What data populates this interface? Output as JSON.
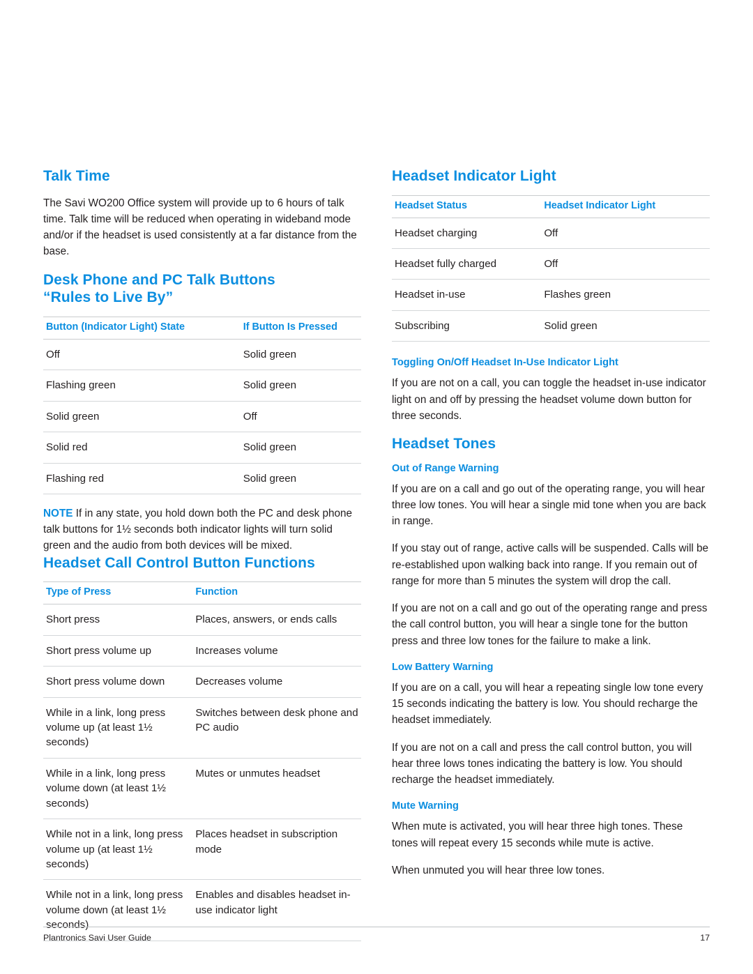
{
  "left": {
    "talk_time": {
      "heading": "Talk Time",
      "paragraph": "The Savi WO200 Office system will provide up to 6 hours of talk time. Talk time will be reduced when operating in wideband mode and/or if the headset is used consistently at a far distance from the base."
    },
    "rules": {
      "heading_line1": "Desk Phone and PC Talk Buttons",
      "heading_line2": "“Rules to Live By”",
      "headers": [
        "Button (Indicator Light) State",
        "If Button Is Pressed"
      ],
      "rows": [
        [
          "Off",
          "Solid green"
        ],
        [
          "Flashing green",
          "Solid green"
        ],
        [
          "Solid green",
          "Off"
        ],
        [
          "Solid red",
          "Solid green"
        ],
        [
          "Flashing red",
          "Solid green"
        ]
      ],
      "note_label": "NOTE",
      "note_text": "If in any state, you hold down both the PC and desk phone talk buttons for 1½ seconds both indicator lights will turn solid green and the audio from both devices will be mixed."
    },
    "call_control": {
      "heading": "Headset Call Control Button Functions",
      "headers": [
        "Type of Press",
        "Function"
      ],
      "rows": [
        [
          "Short press",
          "Places, answers, or ends calls"
        ],
        [
          "Short press volume up",
          "Increases volume"
        ],
        [
          "Short press volume down",
          "Decreases volume"
        ],
        [
          "While in a link, long press volume up (at least 1½ seconds)",
          "Switches between desk phone and PC audio"
        ],
        [
          "While in a link, long press volume down (at least 1½ seconds)",
          "Mutes or unmutes headset"
        ],
        [
          "While not in a link, long press volume up (at least 1½ seconds)",
          "Places headset in subscription mode"
        ],
        [
          "While not in a link, long press volume down (at least 1½ seconds)",
          "Enables and disables headset in-use indicator light"
        ]
      ]
    }
  },
  "right": {
    "indicator": {
      "heading": "Headset Indicator Light",
      "headers": [
        "Headset Status",
        "Headset Indicator Light"
      ],
      "rows": [
        [
          "Headset charging",
          "Off"
        ],
        [
          "Headset fully charged",
          "Off"
        ],
        [
          "Headset in-use",
          "Flashes green"
        ],
        [
          "Subscribing",
          "Solid green"
        ]
      ]
    },
    "toggling": {
      "subhead": "Toggling On/Off Headset In-Use Indicator Light",
      "paragraph": "If you are not on a call, you can toggle the headset in-use indicator light on and off by pressing the headset volume down button for three seconds."
    },
    "tones": {
      "heading": "Headset Tones",
      "out_of_range": {
        "subhead": "Out of Range Warning",
        "p1": "If you are on a call and go out of the operating range, you will hear three low tones. You will hear a single mid tone when you are back in range.",
        "p2": "If you stay out of range, active calls will be suspended. Calls will be re-established upon walking back into range. If you remain out of range for more than 5 minutes the system will drop the call.",
        "p3": "If you are not on a call and go out of the operating range and press the call control button, you will hear a single tone for the button press and three low tones for the failure to make a link."
      },
      "low_battery": {
        "subhead": "Low Battery Warning",
        "p1": "If you are on a call, you will hear a repeating single low tone every 15 seconds indicating the battery is low. You should recharge the headset immediately.",
        "p2": "If you are not on a call and press the call control button, you will hear three lows tones indicating the battery is low. You should recharge the headset immediately."
      },
      "mute": {
        "subhead": "Mute Warning",
        "p1": "When mute is activated, you will hear three high tones. These tones will repeat every 15 seconds while mute is active.",
        "p2": "When unmuted you will hear three low tones."
      }
    }
  },
  "footer": {
    "left": "Plantronics Savi User Guide",
    "page": "17"
  },
  "colors": {
    "accent": "#0b8ee0",
    "text": "#231f20",
    "rule": "#c9ccce"
  }
}
